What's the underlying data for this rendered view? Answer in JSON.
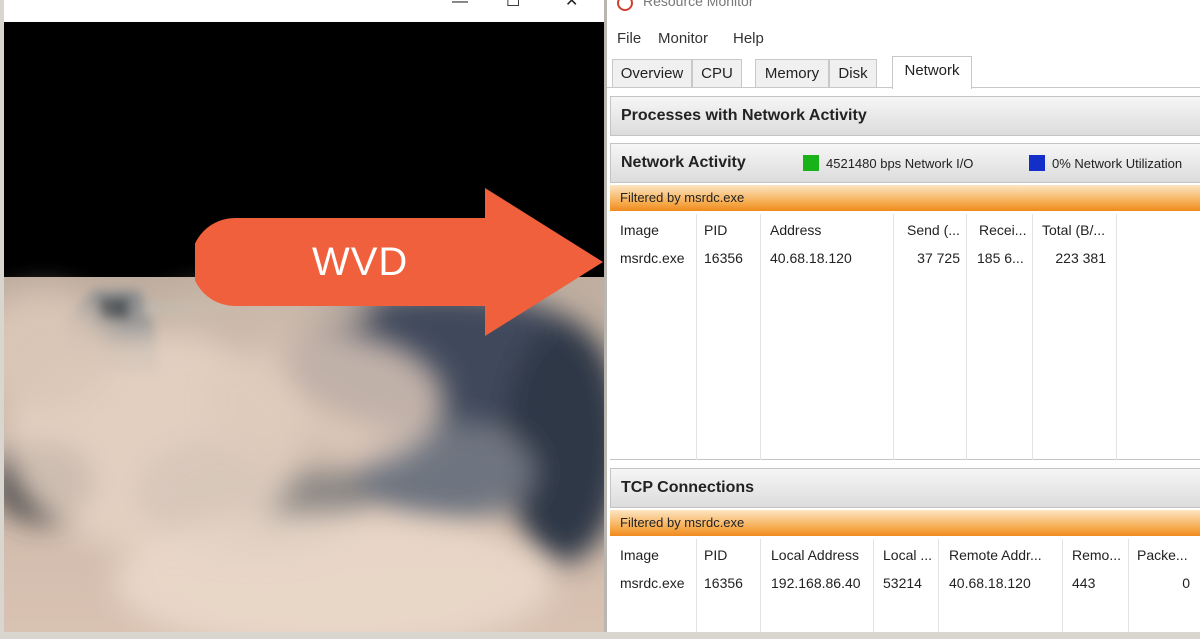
{
  "video_window": {
    "controls": {
      "minimize": "—",
      "maximize": "☐",
      "close": "✕"
    }
  },
  "arrow": {
    "label": "WVD",
    "color": "#f0603c"
  },
  "resource_monitor": {
    "title": "Resource Monitor",
    "menu": [
      "File",
      "Monitor",
      "Help"
    ],
    "tabs": [
      "Overview",
      "CPU",
      "Memory",
      "Disk",
      "Network"
    ],
    "active_tab": "Network",
    "processes_section": {
      "title": "Processes with Network Activity"
    },
    "network_activity": {
      "title": "Network Activity",
      "legend": [
        {
          "color": "#19b319",
          "text": "4521480 bps Network I/O"
        },
        {
          "color": "#1230c8",
          "text": "0% Network Utilization"
        }
      ],
      "filter": "Filtered by msrdc.exe",
      "columns": [
        "Image",
        "PID",
        "Address",
        "Send (...",
        "Recei...",
        "Total (B/..."
      ],
      "rows": [
        {
          "image": "msrdc.exe",
          "pid": "16356",
          "address": "40.68.18.120",
          "send": "37 725",
          "receive": "185 6...",
          "total": "223 381"
        }
      ]
    },
    "tcp_connections": {
      "title": "TCP Connections",
      "filter": "Filtered by msrdc.exe",
      "columns": [
        "Image",
        "PID",
        "Local Address",
        "Local ...",
        "Remote Addr...",
        "Remo...",
        "Packe..."
      ],
      "rows": [
        {
          "image": "msrdc.exe",
          "pid": "16356",
          "local_address": "192.168.86.40",
          "local_port": "53214",
          "remote_address": "40.68.18.120",
          "remote_port": "443",
          "packet_loss": "0"
        }
      ]
    }
  }
}
